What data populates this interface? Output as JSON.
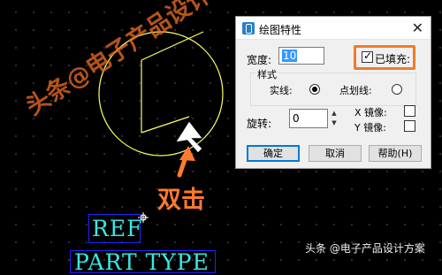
{
  "canvas": {
    "ref_text": "REF",
    "part_text": "PART TYPE"
  },
  "annotation": {
    "double_click": "双击",
    "watermark": "头条@电子产品设计方案",
    "footer": "头条 @电子产品设计方案"
  },
  "dialog": {
    "title": "绘图特性",
    "close": "✕",
    "width_label": "宽度:",
    "width_value": "10",
    "filled_label": "已填充:",
    "filled_checked": true,
    "style_group": "样式",
    "solid_label": "实线:",
    "dotted_label": "点划线:",
    "line_style": "solid",
    "rotation_label": "旋转:",
    "rotation_value": "0",
    "spin_up": "▲",
    "spin_down": "▼",
    "x_mirror_label": "X 镜像:",
    "y_mirror_label": "Y 镜像:",
    "ok_label": "确定",
    "cancel_label": "取消",
    "help_label": "帮助(H)"
  },
  "colors": {
    "canvas_bg": "#000000",
    "shape_stroke": "#ffff66",
    "text_cyan": "#38e8e8",
    "box_blue": "#2222ff",
    "highlight_orange": "#f07b2a"
  },
  "icons": [
    "app-icon",
    "close-icon",
    "arrow-icon",
    "cursor-icon",
    "origin-marker-icon"
  ]
}
